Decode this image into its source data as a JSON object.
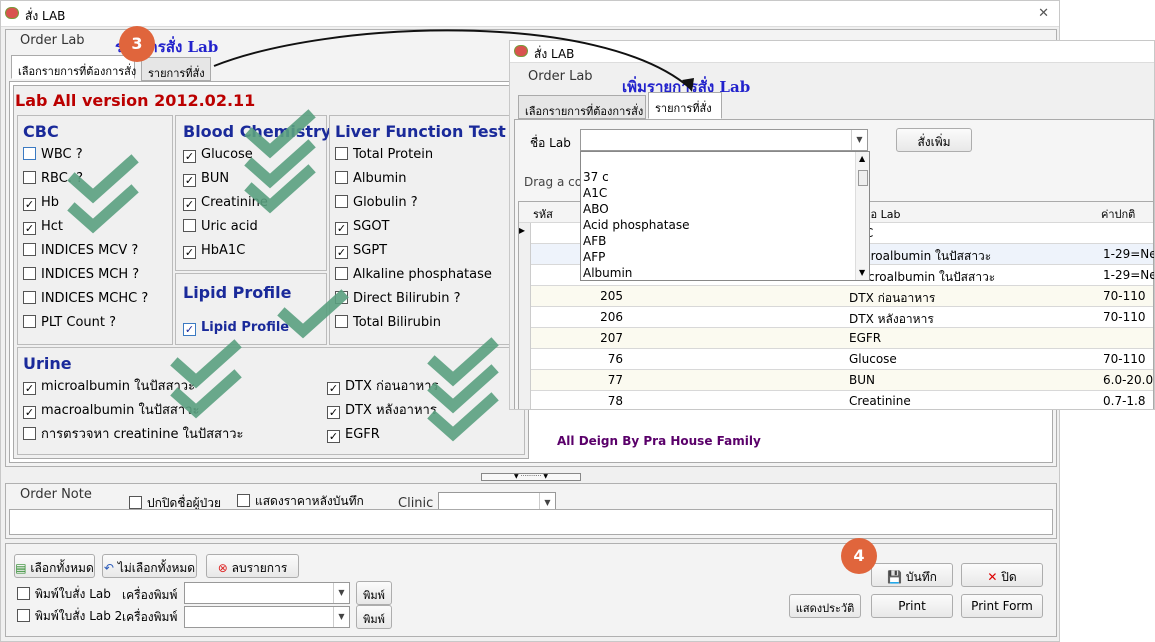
{
  "main": {
    "title": "สั่ง LAB",
    "close_glyph": "✕",
    "group_title": "Order Lab",
    "tabs": [
      "เลือกรายการที่ต้องการสั่ง",
      "รายการที่สั่ง"
    ],
    "overlay_text": "รายการสั่ง Lab",
    "version": "Lab All version 2012.02.11",
    "cbc": {
      "title": "CBC",
      "items": [
        "WBC ?",
        "RBC. ?",
        "Hb",
        "Hct",
        "INDICES MCV ?",
        "INDICES MCH ?",
        "INDICES MCHC ?",
        "PLT Count ?"
      ]
    },
    "blood": {
      "title": "Blood Chemistry",
      "items": [
        "Glucose",
        "BUN",
        "Creatinine",
        "Uric acid",
        "HbA1C"
      ]
    },
    "liver": {
      "title": "Liver Function Test",
      "items": [
        "Total Protein",
        "Albumin",
        "Globulin ?",
        "SGOT",
        "SGPT",
        "Alkaline phosphatase",
        "Direct Bilirubin ?",
        "Total Bilirubin"
      ]
    },
    "lipid": {
      "title": "Lipid Profile",
      "item": "Lipid Profile"
    },
    "urine": {
      "title": "Urine",
      "left": [
        "microalbumin ในปัสสาวะ",
        "macroalbumin ในปัสสาวะ",
        "การตรวจหา creatinine  ในปัสสาวะ"
      ],
      "right": [
        "DTX ก่อนอาหาร",
        "DTX หลังอาหาร",
        "EGFR"
      ]
    },
    "credit": "All Deign By Pra House Family",
    "order_note": "Order Note",
    "hide_name": "ปกปิดชื่อผู้ป่วย",
    "show_price": "แสดงราคาหลังบันทึก",
    "clinic": "Clinic",
    "select_all": "เลือกทั้งหมด",
    "deselect_all": "ไม่เลือกทั้งหมด",
    "delete_items": "ลบรายการ",
    "print_lab": "พิมพ์ใบสั่ง Lab",
    "printer": "เครื่องพิมพ์",
    "print_lab2": "พิมพ์ใบสั่ง Lab 2",
    "print_btn": "พิมพ์",
    "save": "บันทึก",
    "close": "ปิด",
    "history": "แสดงประวัติ",
    "print": "Print",
    "print_form": "Print Form",
    "badge3": "3",
    "badge4": "4"
  },
  "second": {
    "title": "สั่ง LAB",
    "group_title": "Order Lab",
    "overlay_text": "เพิ่มรายการสั่ง Lab",
    "tabs": [
      "เลือกรายการที่ต้องการสั่ง",
      "รายการที่สั่ง"
    ],
    "lab_name_label": "ชื่อ Lab",
    "add_button": "สั่งเพิ่ม",
    "drag_text": "Drag a co",
    "columns": [
      "รหัส",
      "ชื่อ Lab",
      "ค่าปกติ"
    ],
    "dropdown": [
      "37 c",
      "A1C",
      "ABO",
      "Acid phosphatase",
      "AFB",
      "AFP",
      "Albumin"
    ],
    "rows": [
      {
        "code": "",
        "name": "A1C",
        "normal": ""
      },
      {
        "code": "",
        "name": "microalbumin ในปัสสาวะ",
        "normal": "1-29=Ne"
      },
      {
        "code": "",
        "name": "macroalbumin ในปัสสาวะ",
        "normal": "1-29=Ne"
      },
      {
        "code": "205",
        "name": "DTX ก่อนอาหาร",
        "normal": "70-110"
      },
      {
        "code": "206",
        "name": "DTX หลังอาหาร",
        "normal": "70-110"
      },
      {
        "code": "207",
        "name": "EGFR",
        "normal": ""
      },
      {
        "code": "76",
        "name": "Glucose",
        "normal": "70-110"
      },
      {
        "code": "77",
        "name": "BUN",
        "normal": "6.0-20.0"
      },
      {
        "code": "78",
        "name": "Creatinine",
        "normal": "0.7-1.8"
      }
    ]
  }
}
